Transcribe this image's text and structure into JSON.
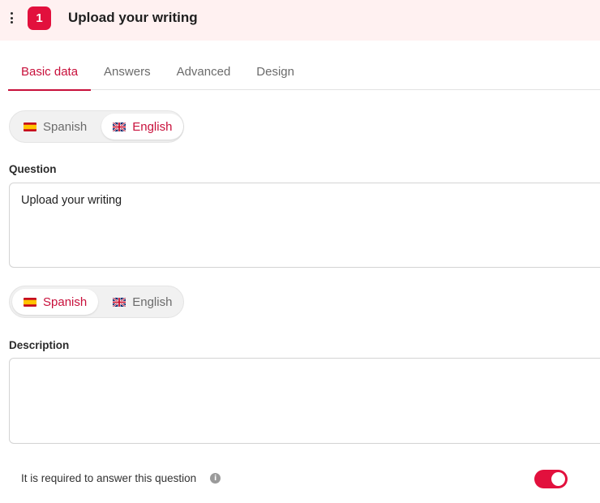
{
  "header": {
    "number": "1",
    "title": "Upload your writing"
  },
  "tabs": [
    {
      "label": "Basic data",
      "active": true
    },
    {
      "label": "Answers",
      "active": false
    },
    {
      "label": "Advanced",
      "active": false
    },
    {
      "label": "Design",
      "active": false
    }
  ],
  "question_lang": {
    "options": [
      {
        "label": "Spanish",
        "flag": "spain-flag-icon",
        "active": false
      },
      {
        "label": "English",
        "flag": "uk-flag-icon",
        "active": true
      }
    ]
  },
  "question": {
    "label": "Question",
    "value": "Upload your writing"
  },
  "description_lang": {
    "options": [
      {
        "label": "Spanish",
        "flag": "spain-flag-icon",
        "active": true
      },
      {
        "label": "English",
        "flag": "uk-flag-icon",
        "active": false
      }
    ]
  },
  "description": {
    "label": "Description",
    "value": ""
  },
  "required": {
    "label": "It is required to answer this question",
    "info_icon": "info-icon",
    "enabled": true
  },
  "colors": {
    "accent": "#e2103d",
    "accent_text": "#c8103b",
    "header_bg": "#fff1f1"
  }
}
